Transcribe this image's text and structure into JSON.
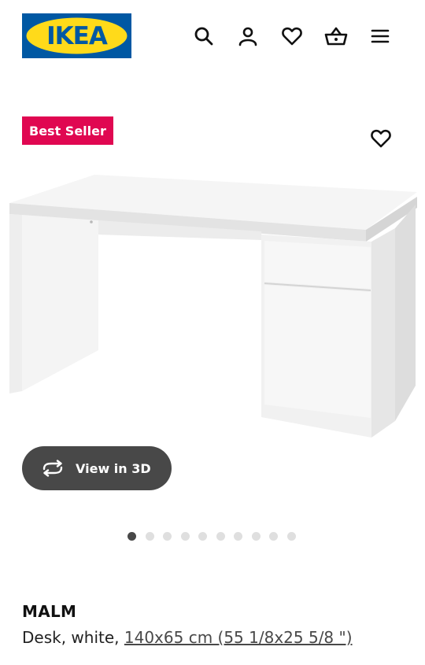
{
  "header": {
    "logo_text": "IKEA",
    "icons": [
      "search-icon",
      "user-icon",
      "heart-icon",
      "basket-icon",
      "menu-icon"
    ]
  },
  "badge": {
    "label": "Best Seller",
    "color": "#e00751"
  },
  "product": {
    "image_icon": "desk-image",
    "view3d_label": "View in 3D",
    "name": "MALM",
    "description_prefix": "Desk, white, ",
    "size": "140x65 cm (55 1/8x25 5/8 \")"
  },
  "carousel": {
    "total": 10,
    "active": 1
  },
  "colors": {
    "brand_blue": "#0058a3",
    "brand_yellow": "#ffda1a",
    "dark": "#484848"
  }
}
